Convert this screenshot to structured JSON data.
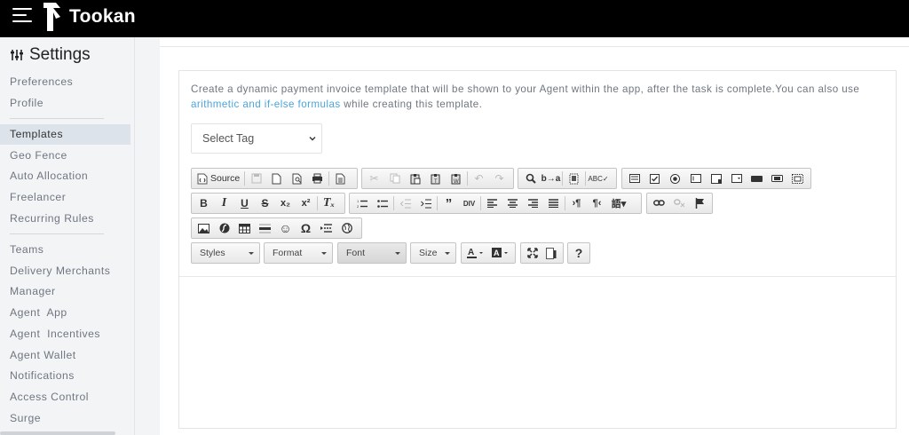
{
  "app": {
    "name": "Tookan"
  },
  "sidebar": {
    "title": "Settings",
    "groups": [
      [
        "Preferences",
        "Profile"
      ],
      [
        "Templates",
        "Geo Fence",
        "Auto Allocation",
        "Freelancer",
        "Recurring Rules"
      ],
      [
        "Teams",
        "Delivery Merchants",
        "Manager",
        "Agent  App",
        "Agent  Incentives",
        "Agent Wallet",
        "Notifications",
        "Access Control",
        "Surge"
      ]
    ],
    "active": "Templates"
  },
  "main": {
    "description_text": "Create a dynamic payment invoice template that will be shown to your Agent within the app, after the task is complete.You can also use ",
    "description_link": "arithmetic and if-else formulas",
    "description_tail": " while creating this template.",
    "select_tag": {
      "value": "Select Tag"
    }
  },
  "toolbar": {
    "source_label": "Source",
    "styles_label": "Styles",
    "format_label": "Format",
    "font_label": "Font",
    "size_label": "Size",
    "help_label": "?",
    "subscript": "x₂",
    "superscript": "x²"
  },
  "colors": {
    "topbar": "#000000",
    "link": "#4aa4dd",
    "active_item_bg": "#dde3ea"
  }
}
